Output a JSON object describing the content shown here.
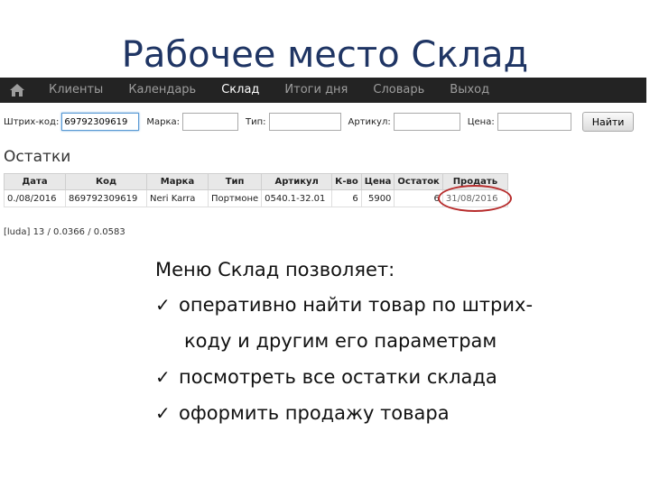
{
  "slide": {
    "title": "Рабочее место Склад"
  },
  "navbar": {
    "items": [
      {
        "label": "Клиенты"
      },
      {
        "label": "Календарь"
      },
      {
        "label": "Склад"
      },
      {
        "label": "Итоги дня"
      },
      {
        "label": "Словарь"
      },
      {
        "label": "Выход"
      }
    ],
    "active_index": 2
  },
  "search": {
    "barcode_label": "Штрих-код:",
    "barcode_value": "69792309619",
    "mark_label": "Марка:",
    "type_label": "Тип:",
    "article_label": "Артикул:",
    "price_label": "Цена:",
    "find_label": "Найти"
  },
  "stock": {
    "title": "Остатки",
    "headers": [
      "Дата",
      "Код",
      "Марка",
      "Тип",
      "Артикул",
      "К-во",
      "Цена",
      "Остаток",
      "Продать"
    ],
    "rows": [
      [
        "0./08/2016",
        "869792309619",
        "Neri Karra",
        "Портмоне",
        "0540.1-32.01",
        "6",
        "5900",
        "6",
        "31/08/2016"
      ]
    ]
  },
  "status": {
    "user_line": "[luda] 13 / 0.0366 / 0.0583"
  },
  "features": {
    "intro": "Меню Склад позволяет:",
    "items": [
      {
        "line1": "оперативно найти товар по штрих-",
        "line2": "коду и другим его параметрам"
      },
      {
        "line1": "посмотреть все остатки склада"
      },
      {
        "line1": "оформить продажу товара"
      }
    ]
  },
  "colors": {
    "title": "#1f3564",
    "navbar_bg": "#232323",
    "highlight_oval": "#b72c2c"
  }
}
